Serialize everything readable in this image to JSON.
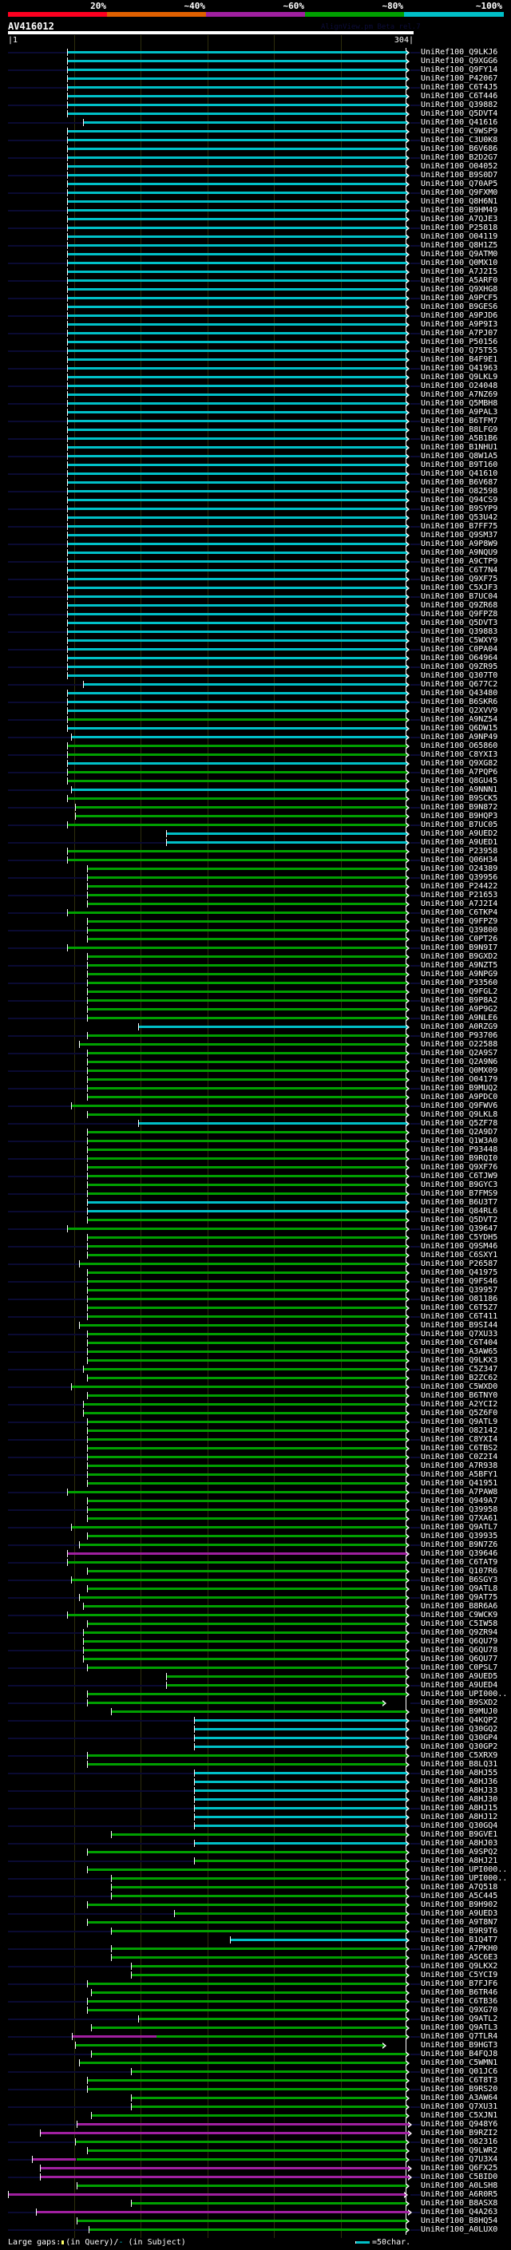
{
  "header": {
    "score_labels": [
      "20%",
      "~40%",
      "~60%",
      "~80%",
      "~100%"
    ],
    "score_colors": [
      "#ff0020",
      "#e06000",
      "#a020a0",
      "#00a000",
      "#00c0c8"
    ],
    "query_id": "AV416012",
    "credit": "AlignView.pm Beta rel.7",
    "query_start": "|1",
    "query_end": "304|"
  },
  "query_length": 304,
  "label_prefix": "UniRef100_",
  "default_end": 298,
  "colors": {
    "c": "#00c0c8",
    "g": "#00a000",
    "m": "#a020a0",
    "navy": "#0a0a32"
  },
  "rows": [
    [
      "Q9LKJ6",
      "c",
      45
    ],
    [
      "Q9XGG6",
      "c",
      45
    ],
    [
      "Q9FY14",
      "c",
      45
    ],
    [
      "P42067",
      "c",
      45
    ],
    [
      "C6T4J5",
      "c",
      45
    ],
    [
      "C6T446",
      "c",
      45
    ],
    [
      "Q39882",
      "c",
      45
    ],
    [
      "Q5DVT4",
      "c",
      45
    ],
    [
      "Q41616",
      "c",
      57
    ],
    [
      "C9WSP9",
      "c",
      45
    ],
    [
      "C3U0K8",
      "c",
      45
    ],
    [
      "B6V686",
      "c",
      45
    ],
    [
      "B2D2G7",
      "c",
      45
    ],
    [
      "O04052",
      "c",
      45
    ],
    [
      "B9S0D7",
      "c",
      45
    ],
    [
      "Q70AP5",
      "c",
      45
    ],
    [
      "Q9FXM0",
      "c",
      45
    ],
    [
      "Q8H6N1",
      "c",
      45
    ],
    [
      "B9HM49",
      "c",
      45
    ],
    [
      "A7QJE3",
      "c",
      45
    ],
    [
      "P25818",
      "c",
      45
    ],
    [
      "O04119",
      "c",
      45
    ],
    [
      "Q8H1Z5",
      "c",
      45
    ],
    [
      "Q9ATM0",
      "c",
      45
    ],
    [
      "Q0MX10",
      "c",
      45
    ],
    [
      "A7J2I5",
      "c",
      45
    ],
    [
      "A5ARF0",
      "c",
      45
    ],
    [
      "Q9XHG8",
      "c",
      45
    ],
    [
      "A9PCF5",
      "c",
      45
    ],
    [
      "B9GES6",
      "c",
      45
    ],
    [
      "A9PJD6",
      "c",
      45
    ],
    [
      "A9P9I3",
      "c",
      45
    ],
    [
      "A7PJ07",
      "c",
      45
    ],
    [
      "P50156",
      "c",
      45
    ],
    [
      "Q75T55",
      "c",
      45
    ],
    [
      "B4F9E1",
      "c",
      45
    ],
    [
      "Q41963",
      "c",
      45
    ],
    [
      "Q9LKL9",
      "c",
      45
    ],
    [
      "O24048",
      "c",
      45
    ],
    [
      "A7NZ69",
      "c",
      45
    ],
    [
      "Q5MBH8",
      "c",
      45
    ],
    [
      "A9PAL3",
      "c",
      45
    ],
    [
      "B6TFM7",
      "c",
      45
    ],
    [
      "B8LFG9",
      "c",
      45
    ],
    [
      "A5B1B6",
      "c",
      45
    ],
    [
      "B1NHU1",
      "c",
      45
    ],
    [
      "Q8W1A5",
      "c",
      45
    ],
    [
      "B9T160",
      "c",
      45
    ],
    [
      "Q41610",
      "c",
      45
    ],
    [
      "B6V687",
      "c",
      45
    ],
    [
      "O82598",
      "c",
      45
    ],
    [
      "Q94CS9",
      "c",
      45
    ],
    [
      "B9SYP9",
      "c",
      45
    ],
    [
      "Q53U42",
      "c",
      45
    ],
    [
      "B7FF75",
      "c",
      45
    ],
    [
      "Q9SM37",
      "c",
      45
    ],
    [
      "A9P8W9",
      "c",
      45
    ],
    [
      "A9NQU9",
      "c",
      45
    ],
    [
      "A9CTP9",
      "c",
      45
    ],
    [
      "C6T7N4",
      "c",
      45
    ],
    [
      "Q9XF75",
      "c",
      45
    ],
    [
      "C5XJF3",
      "c",
      45
    ],
    [
      "B7UC04",
      "c",
      45
    ],
    [
      "Q9ZR68",
      "c",
      45
    ],
    [
      "Q9FPZ8",
      "c",
      45
    ],
    [
      "Q5DVT3",
      "c",
      45
    ],
    [
      "Q39883",
      "c",
      45
    ],
    [
      "C5WXY9",
      "c",
      45
    ],
    [
      "C0PA04",
      "c",
      45
    ],
    [
      "O64964",
      "c",
      45
    ],
    [
      "Q9ZR95",
      "c",
      45
    ],
    [
      "Q307T0",
      "c",
      45
    ],
    [
      "Q677C2",
      "c",
      57
    ],
    [
      "Q43480",
      "c",
      45
    ],
    [
      "B6SKR6",
      "c",
      45
    ],
    [
      "Q2XVV9",
      "c",
      45
    ],
    [
      "A9NZ54",
      "g",
      45
    ],
    [
      "Q6DW15",
      "c",
      45
    ],
    [
      "A9NP49",
      "c",
      48
    ],
    [
      "O65860",
      "g",
      45
    ],
    [
      "C8YXI3",
      "g",
      45
    ],
    [
      "Q9XG82",
      "c",
      45
    ],
    [
      "A7PQP6",
      "g",
      45
    ],
    [
      "Q8GU45",
      "g",
      45
    ],
    [
      "A9NNN1",
      "c",
      48
    ],
    [
      "B9SCK5",
      "g",
      45
    ],
    [
      "B9N872",
      "g",
      51
    ],
    [
      "B9HQP3",
      "g",
      51
    ],
    [
      "B7UC05",
      "g",
      45
    ],
    [
      "A9UED2",
      "c",
      119
    ],
    [
      "A9UED1",
      "c",
      119
    ],
    [
      "P23958",
      "g",
      45
    ],
    [
      "Q06H34",
      "g",
      45
    ],
    [
      "O24389",
      "g",
      60
    ],
    [
      "Q39956",
      "g",
      60
    ],
    [
      "P24422",
      "g",
      60
    ],
    [
      "P21653",
      "g",
      60
    ],
    [
      "A7J2I4",
      "g",
      60
    ],
    [
      "C6TKP4",
      "g",
      45
    ],
    [
      "Q9FPZ9",
      "g",
      60
    ],
    [
      "Q39800",
      "g",
      60
    ],
    [
      "C0PT26",
      "g",
      60
    ],
    [
      "B9N9I7",
      "g",
      45
    ],
    [
      "B9GXD2",
      "g",
      60
    ],
    [
      "A9NZT5",
      "g",
      60
    ],
    [
      "A9NPG9",
      "g",
      60
    ],
    [
      "P33560",
      "g",
      60
    ],
    [
      "Q9FGL2",
      "g",
      60
    ],
    [
      "B9P8A2",
      "g",
      60
    ],
    [
      "A9P9G2",
      "g",
      60
    ],
    [
      "A9NLE6",
      "g",
      60
    ],
    [
      "A0RZG9",
      "c",
      98
    ],
    [
      "P93706",
      "g",
      60
    ],
    [
      "O22588",
      "g",
      54
    ],
    [
      "Q2A9S7",
      "g",
      60
    ],
    [
      "Q2A9N6",
      "g",
      60
    ],
    [
      "Q0MX09",
      "g",
      60
    ],
    [
      "O04179",
      "g",
      60
    ],
    [
      "B9MUQ2",
      "g",
      60
    ],
    [
      "A9PDC0",
      "g",
      60
    ],
    [
      "Q9FWV6",
      "g",
      48
    ],
    [
      "Q9LKL8",
      "g",
      60
    ],
    [
      "Q5ZF78",
      "c",
      98
    ],
    [
      "Q2A9D7",
      "g",
      60
    ],
    [
      "Q1W3A0",
      "g",
      60
    ],
    [
      "P93448",
      "g",
      60
    ],
    [
      "B9RQI0",
      "g",
      60
    ],
    [
      "Q9XF76",
      "g",
      60
    ],
    [
      "C6TJW9",
      "g",
      60
    ],
    [
      "B9GYC3",
      "g",
      60
    ],
    [
      "B7FMS9",
      "g",
      60
    ],
    [
      "B6U3T7",
      "c",
      60
    ],
    [
      "Q84RL6",
      "c",
      60
    ],
    [
      "Q5DVT2",
      "g",
      60
    ],
    [
      "Q39647",
      "g",
      45
    ],
    [
      "C5YDH5",
      "g",
      60
    ],
    [
      "Q9SM46",
      "g",
      60
    ],
    [
      "C6SXY1",
      "g",
      60
    ],
    [
      "P26587",
      "g",
      54
    ],
    [
      "Q41975",
      "g",
      60
    ],
    [
      "Q9FS46",
      "g",
      60
    ],
    [
      "Q39957",
      "g",
      60
    ],
    [
      "O81186",
      "g",
      60
    ],
    [
      "C6T5Z7",
      "g",
      60
    ],
    [
      "C6T411",
      "g",
      60
    ],
    [
      "B9SI44",
      "g",
      54
    ],
    [
      "Q7XU33",
      "g",
      60
    ],
    [
      "C6T404",
      "g",
      60
    ],
    [
      "A3AW65",
      "g",
      60
    ],
    [
      "Q9LKX3",
      "g",
      60
    ],
    [
      "C5Z347",
      "g",
      57
    ],
    [
      "B2ZC62",
      "g",
      60
    ],
    [
      "C5WXD0",
      "g",
      48
    ],
    [
      "B6TNY0",
      "g",
      60
    ],
    [
      "A2YCI2",
      "g",
      57
    ],
    [
      "Q5Z6F0",
      "g",
      57
    ],
    [
      "Q9ATL9",
      "g",
      60
    ],
    [
      "O82142",
      "g",
      60
    ],
    [
      "C8YXI4",
      "g",
      60
    ],
    [
      "C6TBS2",
      "g",
      60
    ],
    [
      "C0Z2I4",
      "g",
      60
    ],
    [
      "A7R938",
      "g",
      60
    ],
    [
      "A5BFY1",
      "g",
      60
    ],
    [
      "Q41951",
      "g",
      60
    ],
    [
      "A7PAW8",
      "g",
      45
    ],
    [
      "Q949A7",
      "g",
      60
    ],
    [
      "Q39958",
      "g",
      60
    ],
    [
      "Q7XA61",
      "g",
      60
    ],
    [
      "Q9ATL7",
      "g",
      48
    ],
    [
      "Q39935",
      "g",
      60
    ],
    [
      "B9N7Z6",
      "g",
      54
    ],
    [
      "Q39646",
      "m",
      45
    ],
    [
      "C6TAT9",
      "g",
      45
    ],
    [
      "Q107R6",
      "g",
      60
    ],
    [
      "B6SGY3",
      "g",
      48
    ],
    [
      "Q9ATL8",
      "g",
      60
    ],
    [
      "Q9AT75",
      "g",
      54
    ],
    [
      "B8R6A6",
      "g",
      57
    ],
    [
      "C9WCK9",
      "g",
      45
    ],
    [
      "C5IW58",
      "g",
      60
    ],
    [
      "Q9ZR94",
      "g",
      57
    ],
    [
      "Q6QU79",
      "g",
      57
    ],
    [
      "Q6QU78",
      "g",
      57
    ],
    [
      "Q6QU77",
      "g",
      57
    ],
    [
      "C0PSL7",
      "g",
      60
    ],
    [
      "A9UED5",
      "g",
      119
    ],
    [
      "A9UED4",
      "g",
      119
    ],
    [
      "UPI000..",
      "g",
      60
    ],
    [
      "B9SXD2",
      "g",
      60,
      281
    ],
    [
      "B9MUJ0",
      "g",
      78
    ],
    [
      "Q4KQP2",
      "c",
      140
    ],
    [
      "Q30GQ2",
      "c",
      140
    ],
    [
      "Q30GP4",
      "c",
      140
    ],
    [
      "Q30GP2",
      "c",
      140
    ],
    [
      "C5XRX9",
      "g",
      60
    ],
    [
      "B8LQ31",
      "g",
      60
    ],
    [
      "A8HJ55",
      "c",
      140
    ],
    [
      "A8HJ36",
      "c",
      140
    ],
    [
      "A8HJ33",
      "c",
      140
    ],
    [
      "A8HJ30",
      "c",
      140
    ],
    [
      "A8HJ15",
      "c",
      140
    ],
    [
      "A8HJ12",
      "c",
      140
    ],
    [
      "Q30GQ4",
      "c",
      140
    ],
    [
      "B9GVE1",
      "g",
      78
    ],
    [
      "A8HJ03",
      "c",
      140
    ],
    [
      "A9SPQ2",
      "g",
      60
    ],
    [
      "A8HJ21",
      "g",
      140
    ],
    [
      "UPI000..",
      "g",
      60
    ],
    [
      "UPI000..",
      "g",
      78
    ],
    [
      "A7Q518",
      "g",
      78
    ],
    [
      "A5C445",
      "g",
      78
    ],
    [
      "B9H902",
      "g",
      60
    ],
    [
      "A9UED3",
      "g",
      125
    ],
    [
      "A9T8N7",
      "g",
      60
    ],
    [
      "B9R9T6",
      "g",
      78
    ],
    [
      "B1Q4T7",
      "c",
      167
    ],
    [
      "A7PKH0",
      "g",
      78
    ],
    [
      "A5C6E3",
      "g",
      78
    ],
    [
      "Q9LKX2",
      "g",
      93
    ],
    [
      "C5YCI9",
      "g",
      93
    ],
    [
      "B7FJF6",
      "g",
      60
    ],
    [
      "B6TR46",
      "g",
      63
    ],
    [
      "C6TB36",
      "g",
      60
    ],
    [
      "Q9XG70",
      "g",
      60
    ],
    [
      "Q9ATL2",
      "g",
      98
    ],
    [
      "Q9ATL3",
      "g",
      63
    ],
    [
      "Q7TLR4",
      "m",
      49,
      112,
      [
        [
          "g",
          112,
          298
        ]
      ]
    ],
    [
      "B9HGT3",
      "g",
      51,
      281
    ],
    [
      "B4FQJ8",
      "g",
      63
    ],
    [
      "C5WMN1",
      "g",
      54
    ],
    [
      "Q01JC6",
      "g",
      93
    ],
    [
      "C6T8T3",
      "g",
      60
    ],
    [
      "B9RS20",
      "g",
      60
    ],
    [
      "A3AW64",
      "g",
      93
    ],
    [
      "Q7XU31",
      "g",
      93
    ],
    [
      "C5XJN1",
      "g",
      63
    ],
    [
      "Q948Y6",
      "m",
      52,
      300
    ],
    [
      "B9RZI2",
      "m",
      25,
      300
    ],
    [
      "O82316",
      "g",
      51
    ],
    [
      "Q9LWR2",
      "g",
      60
    ],
    [
      "Q7U3X4",
      "m",
      19,
      52,
      [
        [
          "g",
          52,
          298
        ]
      ]
    ],
    [
      "Q6FX25",
      "m",
      25,
      300
    ],
    [
      "C5BID0",
      "m",
      25,
      300
    ],
    [
      "A0LSH8",
      "g",
      52
    ],
    [
      "A6R0R5",
      "m",
      1,
      297
    ],
    [
      "B8ASX8",
      "g",
      93
    ],
    [
      "Q4A263",
      "m",
      22,
      300
    ],
    [
      "B8HQ54",
      "g",
      52
    ],
    [
      "A0LUX0",
      "g",
      61
    ]
  ],
  "footer": {
    "gaps_label": "Large gaps:",
    "in_query": "(in Query)/",
    "subject_mark": "-",
    "in_subject": " (in Subject)",
    "scale_label": "=50char."
  }
}
